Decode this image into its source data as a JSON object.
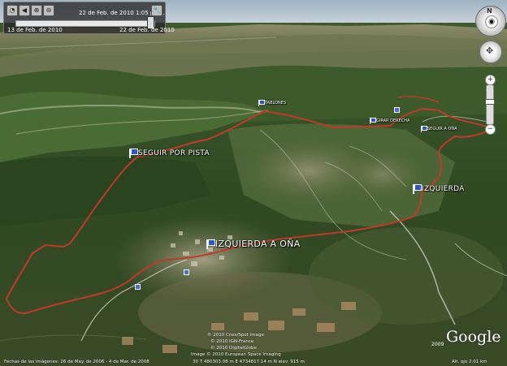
{
  "time_slider": {
    "current_date": "22 de Feb. de 2010   1:05 p. m.",
    "start_date": "13 de Feb. de 2010",
    "end_date": "22 de Feb. de 2010",
    "level": 1.0
  },
  "placemarks": {
    "seguir_por_pista": "SEGUIR POR PISTA",
    "tablones": "TABLONES",
    "girar_derecha": "GIRAR DERECHA",
    "seguir_a_ona": "SEGUIR A OÑA",
    "izquierda": "IZQUIERDA",
    "izquierda_a_ona": "IZQUIERDA A OÑA"
  },
  "navigation": {
    "compass_north": "N",
    "zoom_in": "+",
    "zoom_out": "−"
  },
  "attribution": {
    "line1": "© 2010 Cnes/Spot Image",
    "line2": "© 2010 IGN-France",
    "line3": "© 2010 DigitalGlobe",
    "line4": "Image © 2010 European Space Imaging",
    "google": "Google",
    "year": "2009"
  },
  "status_bar": {
    "imagery_dates": "Fechas de las imágenes: 26 de May. de 2006 - 4 de Mar. de 2008",
    "coordinates": "30 T 480303.08 m E 4734817.14 m N elev. 915 m",
    "altitude": "Alt. ojo  2.01 km"
  },
  "colors": {
    "route": "#c0392b",
    "flag": "#2c56c8",
    "sky": "#c7d4dd"
  }
}
